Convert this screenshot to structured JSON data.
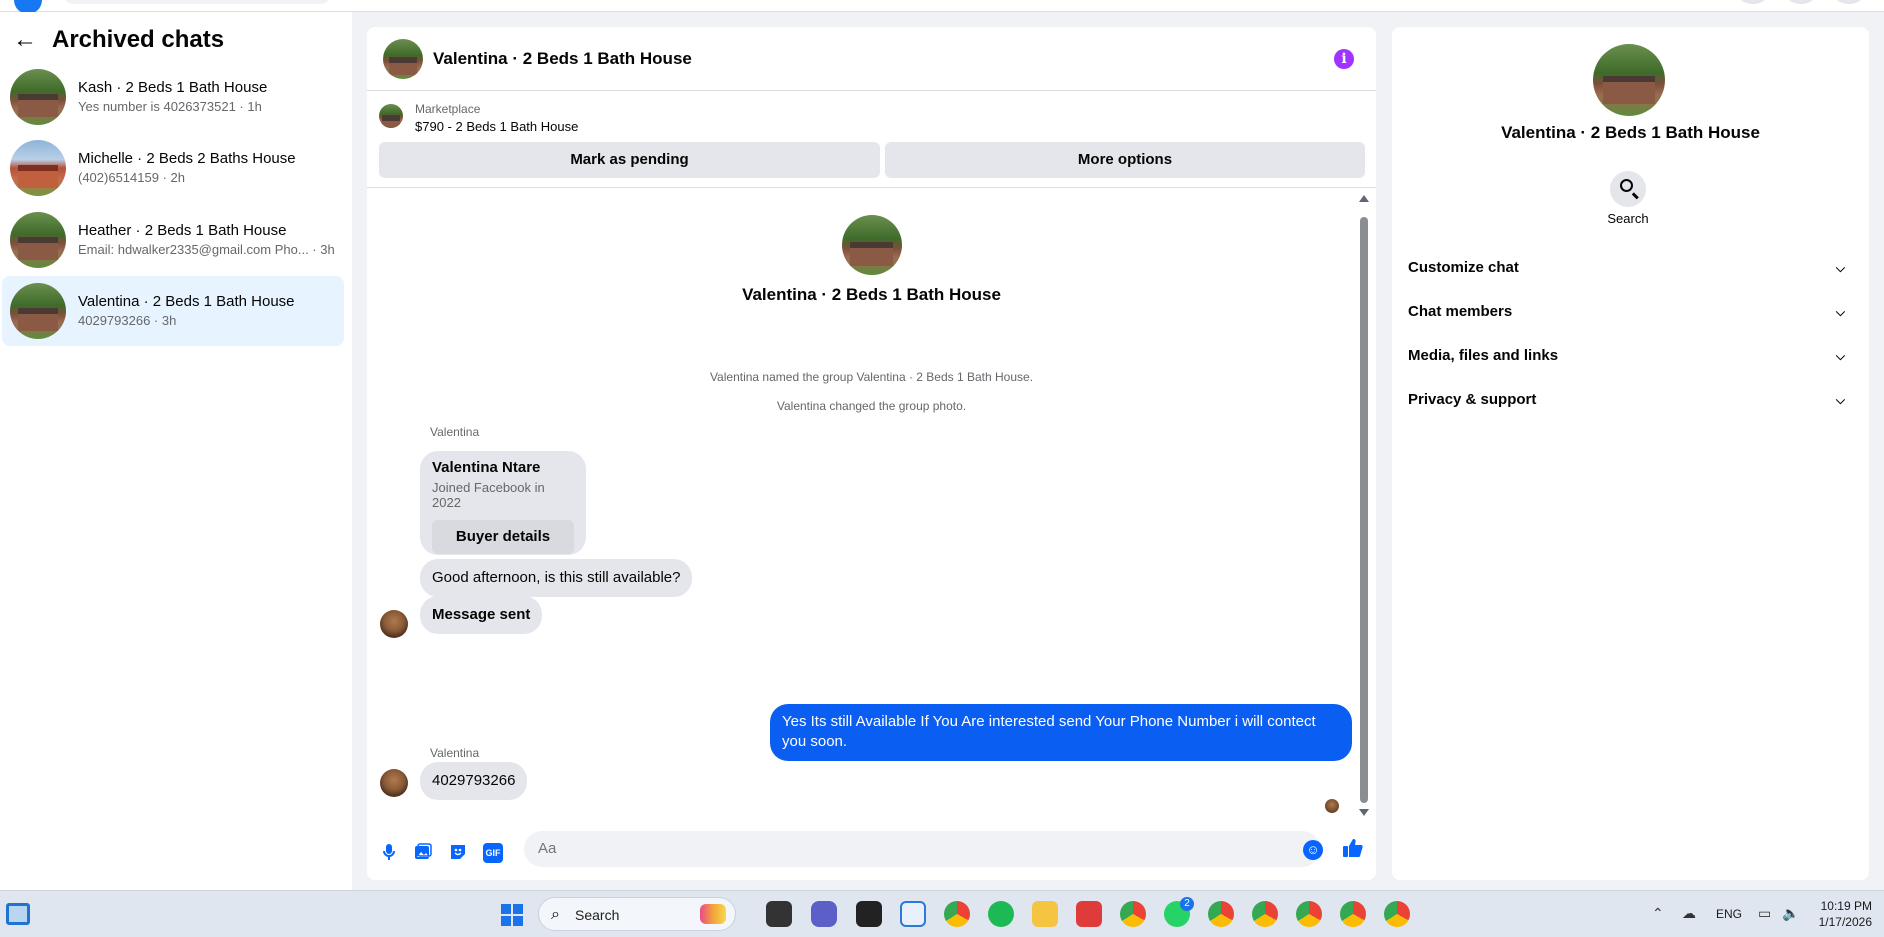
{
  "sidebar": {
    "title": "Archived chats",
    "back_icon": "←",
    "chats": [
      {
        "title": "Kash · 2 Beds 1 Bath House",
        "sub": "Yes number is 4026373521 · 1h"
      },
      {
        "title": "Michelle · 2 Beds 2 Baths House",
        "sub": "(402)6514159 · 2h"
      },
      {
        "title": "Heather · 2 Beds 1 Bath House",
        "sub": "Email: hdwalker2335@gmail.com Pho... · 3h"
      },
      {
        "title": "Valentina · 2 Beds 1 Bath House",
        "sub": "4029793266 · 3h"
      }
    ]
  },
  "conversation": {
    "title": "Valentina · 2 Beds 1 Bath House",
    "info_icon": "i",
    "listing": {
      "source": "Marketplace",
      "price_title": "$790 - 2 Beds 1 Bath House",
      "mark_pending": "Mark as pending",
      "more_options": "More options"
    },
    "thread_name": "Valentina · 2 Beds 1 Bath House",
    "system_messages": [
      "Valentina named the group Valentina · 2 Beds 1 Bath House.",
      "Valentina changed the group photo."
    ],
    "sender_label": "Valentina",
    "buyer_card": {
      "name": "Valentina Ntare",
      "joined": "Joined Facebook in 2022",
      "button": "Buyer details"
    },
    "messages_in": [
      "Good afternoon, is this still available?",
      "Message sent"
    ],
    "message_out": "Yes Its still Available If You Are interested send Your Phone Number i will contect you soon.",
    "sender_label_2": "Valentina",
    "last_message": "4029793266",
    "composer_placeholder": "Aa",
    "composer_icons": [
      "microphone-icon",
      "photo-icon",
      "sticker-icon",
      "gif-icon",
      "emoji-icon",
      "like-icon"
    ],
    "gif_label": "GIF"
  },
  "details": {
    "title": "Valentina · 2 Beds 1 Bath House",
    "search_label": "Search",
    "sections": [
      "Customize chat",
      "Chat members",
      "Media, files and links",
      "Privacy & support"
    ]
  },
  "taskbar": {
    "search_label": "Search",
    "lang": "ENG",
    "time": "10:19 PM",
    "date": "1/17/2026",
    "whatsapp_badge": "2"
  },
  "colors": {
    "accent": "#0866ff",
    "outgoing_bubble": "#0a5ef2",
    "info_icon": "#a033ff",
    "selected_chat": "#e7f3ff"
  }
}
